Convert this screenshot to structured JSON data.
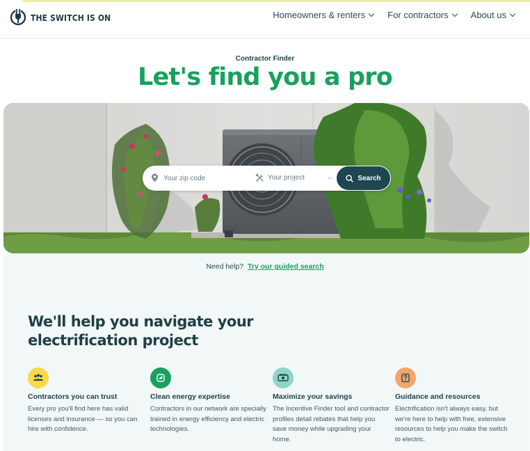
{
  "brand": {
    "name": "THE SWITCH IS ON"
  },
  "nav": {
    "items": [
      {
        "label": "Homeowners & renters"
      },
      {
        "label": "For contractors"
      },
      {
        "label": "About us"
      }
    ]
  },
  "hero": {
    "eyebrow": "Contractor Finder",
    "title": "Let's find you a pro"
  },
  "search": {
    "zip_placeholder": "Your zip code",
    "project_placeholder": "Your project",
    "button_label": "Search"
  },
  "help": {
    "prefix": "Need help?",
    "link_label": "Try our guided search"
  },
  "benefits": {
    "heading": "We'll help you navigate your electrification project",
    "items": [
      {
        "title": "Contractors you can trust",
        "description": "Every pro you'll find here has valid licenses and insurance — so you can hire with confidence.",
        "icon": "people-icon",
        "color": "#f7d94c"
      },
      {
        "title": "Clean energy expertise",
        "description": "Contractors in our network are specially trained in energy efficiency and electric technologies.",
        "icon": "leaf-icon",
        "color": "#1aa05e"
      },
      {
        "title": "Maximize your savings",
        "description": "The Incentive Finder tool and contractor profiles detail rebates that help you save money while upgrading your home.",
        "icon": "money-icon",
        "color": "#8fd5c9"
      },
      {
        "title": "Guidance and resources",
        "description": "Electrification isn't always easy, but we're here to help with free, extensive resources to help you make the switch to electric.",
        "icon": "question-icon",
        "color": "#f3a56a"
      }
    ]
  },
  "colors": {
    "brand_green": "#1aa05e",
    "dark_teal": "#1e4650",
    "light_bg": "#f1f8f7"
  }
}
